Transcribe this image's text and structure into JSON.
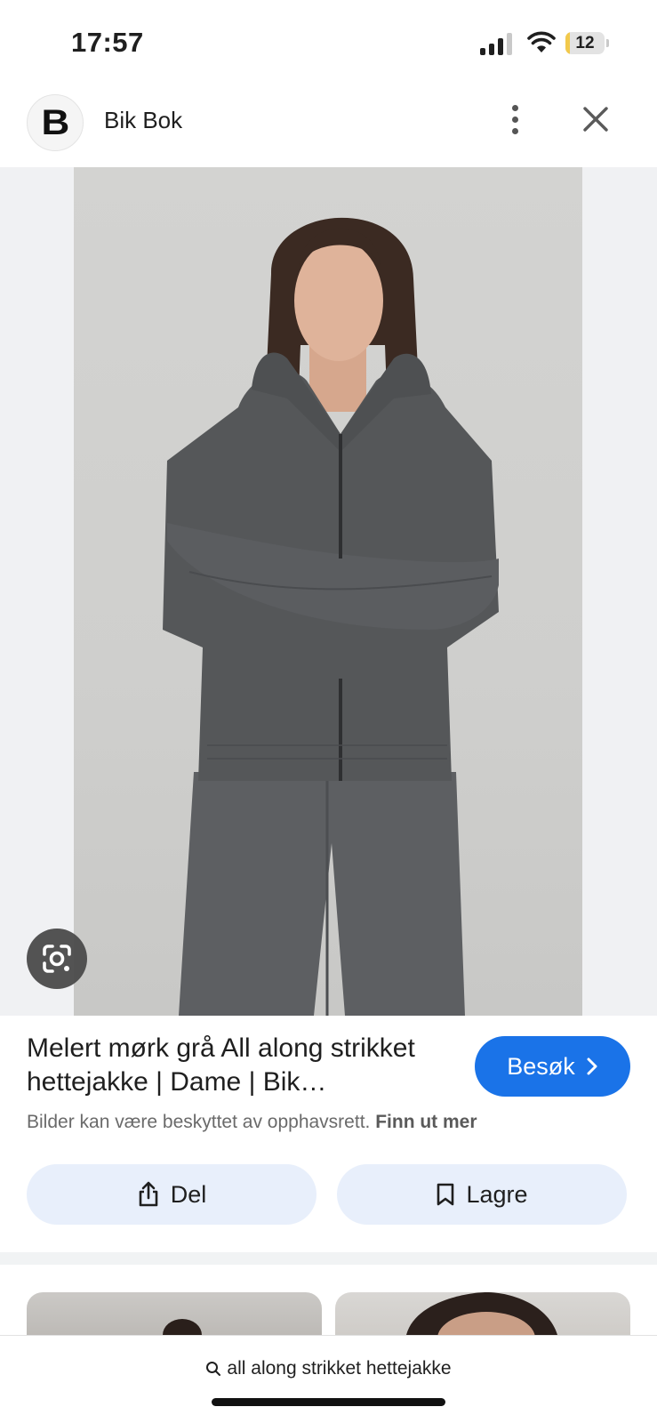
{
  "status_bar": {
    "time": "17:57",
    "battery": "12",
    "battery_level": 0.12
  },
  "header": {
    "logo_letter": "B",
    "site_name": "Bik Bok"
  },
  "result": {
    "title": "Melert mørk grå All along strikket hettejakke | Dame | Bik…",
    "visit_label": "Besøk",
    "copyright_text": "Bilder kan være beskyttet av opphavsrett.",
    "copyright_link": "Finn ut mer",
    "share_label": "Del",
    "save_label": "Lagre"
  },
  "search": {
    "query": "all along strikket hettejakke"
  },
  "colors": {
    "accent": "#1a73e8",
    "action_bg": "#e8effb",
    "battery_fill": "#f2c94c"
  },
  "icons": [
    "signal-icon",
    "wifi-icon",
    "battery-icon",
    "more-vert-icon",
    "close-icon",
    "google-lens-icon",
    "chevron-right-icon",
    "share-icon",
    "bookmark-icon",
    "search-icon"
  ]
}
